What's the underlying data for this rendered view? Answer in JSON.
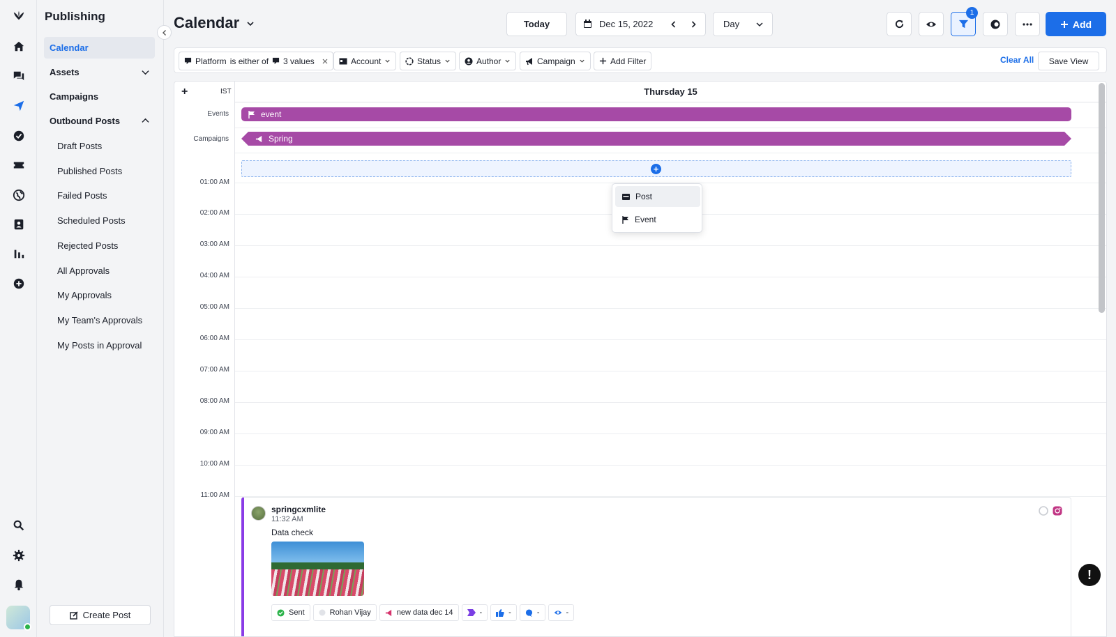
{
  "sidebar": {
    "title": "Publishing",
    "items": [
      {
        "label": "Calendar"
      },
      {
        "label": "Assets"
      },
      {
        "label": "Campaigns"
      },
      {
        "label": "Outbound Posts"
      }
    ],
    "subitems": [
      {
        "label": "Draft Posts"
      },
      {
        "label": "Published Posts"
      },
      {
        "label": "Failed Posts"
      },
      {
        "label": "Scheduled Posts"
      },
      {
        "label": "Rejected Posts"
      },
      {
        "label": "All Approvals"
      },
      {
        "label": "My Approvals"
      },
      {
        "label": "My Team's Approvals"
      },
      {
        "label": "My Posts in Approval"
      }
    ],
    "create_label": "Create Post"
  },
  "header": {
    "title": "Calendar",
    "today_label": "Today",
    "date": "Dec 15, 2022",
    "view": "Day",
    "filter_count": "1",
    "add_label": "Add"
  },
  "filters": {
    "platform_label": "Platform",
    "platform_op": "is either of",
    "platform_values": "3 values",
    "account": "Account",
    "status": "Status",
    "author": "Author",
    "campaign": "Campaign",
    "add_filter": "Add Filter",
    "clear_all": "Clear All",
    "save_view": "Save View"
  },
  "calendar": {
    "timezone": "IST",
    "day_header": "Thursday 15",
    "events_label": "Events",
    "campaigns_label": "Campaigns",
    "event_name": "event",
    "campaign_name": "Spring",
    "hours": [
      "01:00 AM",
      "02:00 AM",
      "03:00 AM",
      "04:00 AM",
      "05:00 AM",
      "06:00 AM",
      "07:00 AM",
      "08:00 AM",
      "09:00 AM",
      "10:00 AM",
      "11:00 AM"
    ],
    "menu": {
      "post": "Post",
      "event": "Event"
    }
  },
  "post": {
    "account": "springcxmlite",
    "time": "11:32 AM",
    "text": "Data check",
    "status": "Sent",
    "author": "Rohan Vijay",
    "campaign": "new data dec 14",
    "stat1": "-",
    "stat2": "-",
    "stat3": "-",
    "stat4": "-"
  },
  "colors": {
    "accent": "#1c6ee8",
    "event_bar": "#a64aa6",
    "post_border": "#8a3ce6"
  }
}
